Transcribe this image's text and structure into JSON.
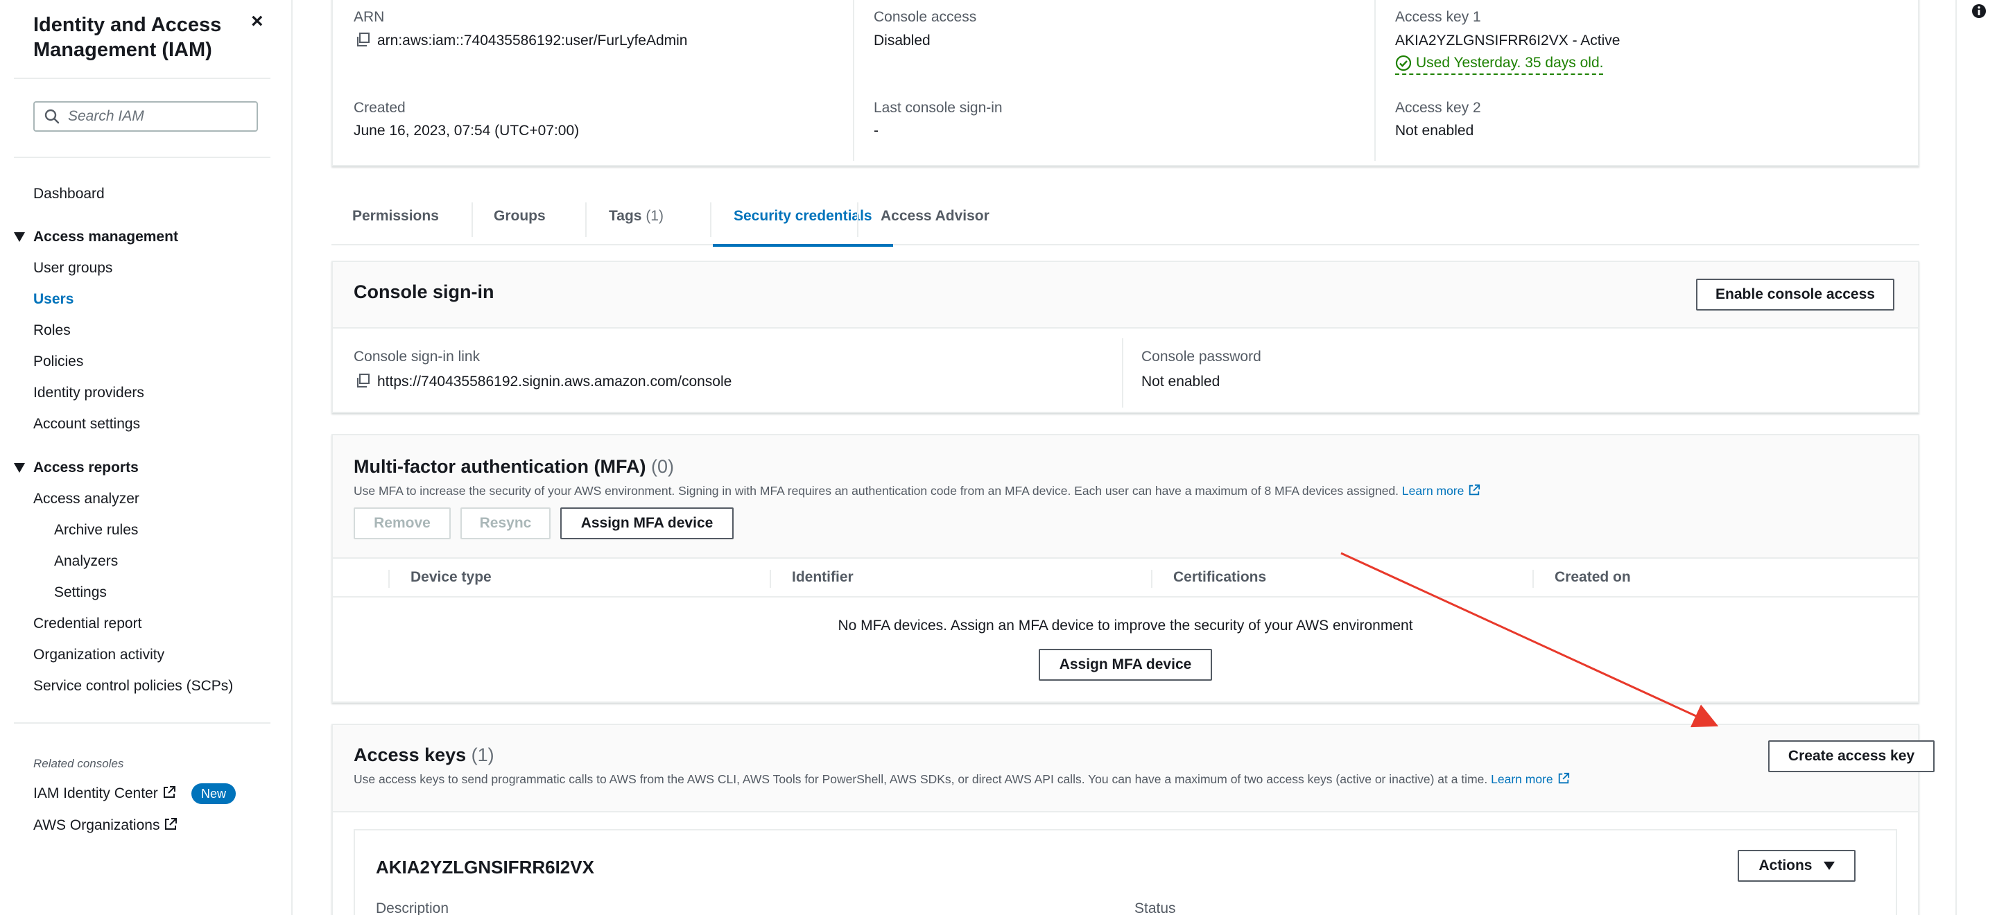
{
  "sidebar": {
    "title": "Identity and Access Management (IAM)",
    "close_label": "×",
    "search_placeholder": "Search IAM",
    "dashboard": "Dashboard",
    "access_management": {
      "label": "Access management",
      "items": [
        "User groups",
        "Users",
        "Roles",
        "Policies",
        "Identity providers",
        "Account settings"
      ],
      "active": "Users"
    },
    "access_reports": {
      "label": "Access reports",
      "items": [
        "Access analyzer",
        "Archive rules",
        "Analyzers",
        "Settings",
        "Credential report",
        "Organization activity",
        "Service control policies (SCPs)"
      ]
    },
    "related": {
      "label": "Related consoles",
      "items": [
        "IAM Identity Center",
        "AWS Organizations"
      ],
      "new_badge": "New"
    }
  },
  "summary": {
    "arn_label": "ARN",
    "arn_value": "arn:aws:iam::740435586192:user/FurLyfeAdmin",
    "created_label": "Created",
    "created_value": "June 16, 2023, 07:54 (UTC+07:00)",
    "console_access_label": "Console access",
    "console_access_value": "Disabled",
    "last_signin_label": "Last console sign-in",
    "last_signin_value": "-",
    "key1_label": "Access key 1",
    "key1_value": "AKIA2YZLGNSIFRR6I2VX - Active",
    "key1_used": "Used Yesterday. 35 days old.",
    "key2_label": "Access key 2",
    "key2_value": "Not enabled"
  },
  "tabs": [
    {
      "label": "Permissions",
      "count": ""
    },
    {
      "label": "Groups",
      "count": ""
    },
    {
      "label": "Tags",
      "count": "(1)"
    },
    {
      "label": "Security credentials",
      "count": ""
    },
    {
      "label": "Access Advisor",
      "count": ""
    }
  ],
  "active_tab": "Security credentials",
  "console_signin": {
    "title": "Console sign-in",
    "enable_button": "Enable console access",
    "link_label": "Console sign-in link",
    "link_value": "https://740435586192.signin.aws.amazon.com/console",
    "password_label": "Console password",
    "password_value": "Not enabled"
  },
  "mfa": {
    "title": "Multi-factor authentication (MFA)",
    "count": "(0)",
    "description": "Use MFA to increase the security of your AWS environment. Signing in with MFA requires an authentication code from an MFA device. Each user can have a maximum of 8 MFA devices assigned.",
    "learn_more": "Learn more",
    "remove_button": "Remove",
    "resync_button": "Resync",
    "assign_button": "Assign MFA device",
    "columns": [
      "Device type",
      "Identifier",
      "Certifications",
      "Created on"
    ],
    "empty_message": "No MFA devices. Assign an MFA device to improve the security of your AWS environment",
    "empty_assign_button": "Assign MFA device"
  },
  "access_keys": {
    "title": "Access keys",
    "count": "(1)",
    "description": "Use access keys to send programmatic calls to AWS from the AWS CLI, AWS Tools for PowerShell, AWS SDKs, or direct AWS API calls. You can have a maximum of two access keys (active or inactive) at a time.",
    "learn_more": "Learn more",
    "create_button": "Create access key",
    "key_id": "AKIA2YZLGNSIFRR6I2VX",
    "actions_button": "Actions",
    "description_label": "Description",
    "status_label": "Status"
  },
  "colors": {
    "link": "#0073bb",
    "success": "#1d8102",
    "annotation_arrow": "#e8392b",
    "badge": "#0073bb"
  }
}
